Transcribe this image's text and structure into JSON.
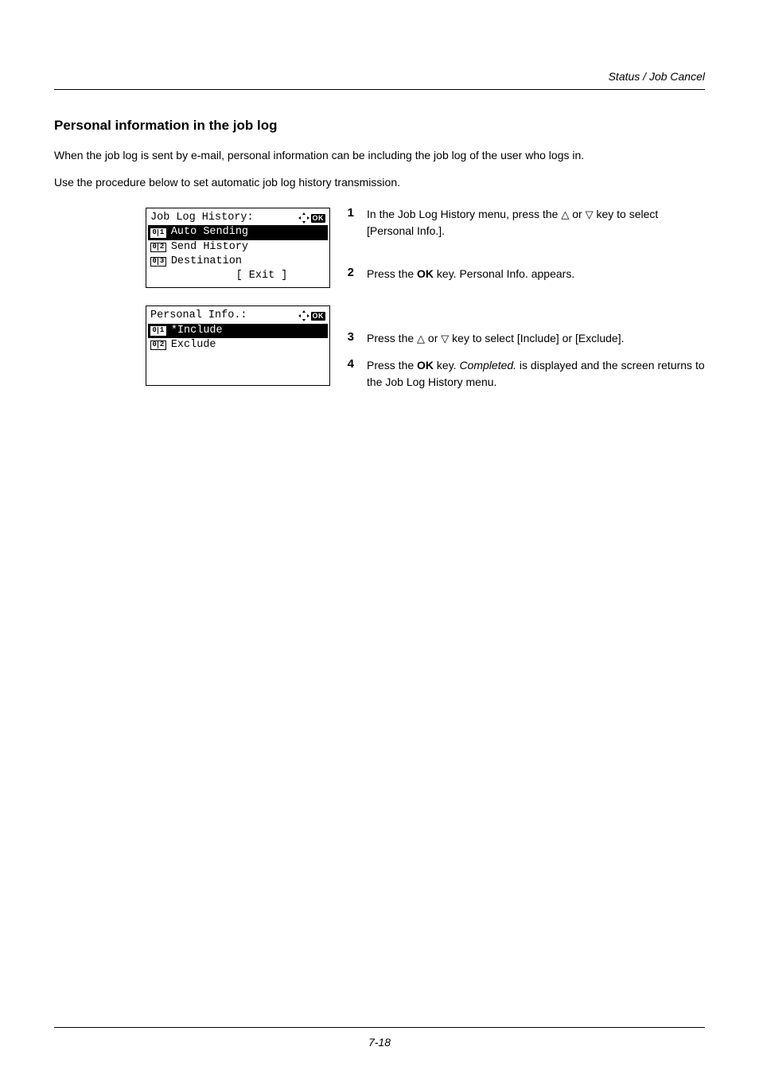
{
  "header": {
    "section": "Status / Job Cancel"
  },
  "title": "Personal information in the job log",
  "intro1": "When the job log is sent by e-mail, personal information can be including the job log of the user who logs in.",
  "intro2": "Use the procedure below to set automatic job log history transmission.",
  "lcd1": {
    "title": "Job Log History:",
    "row1": "Auto Sending",
    "row2": "Send History",
    "row3": "Destination",
    "exit": "[  Exit   ]"
  },
  "lcd2": {
    "title": "Personal Info.:",
    "row1": "*Include",
    "row2": "Exclude"
  },
  "steps": {
    "s1_pre": "In the Job Log History menu, press the ",
    "s1_mid": " or ",
    "s1_post": " key to select [Personal Info.].",
    "s2_pre": "Press the ",
    "s2_ok": "OK",
    "s2_post": " key. Personal Info. appears.",
    "s3_pre": "Press the ",
    "s3_mid": " or ",
    "s3_post": " key to select [Include] or [Exclude].",
    "s4_pre": "Press the ",
    "s4_ok": "OK",
    "s4_mid": " key. ",
    "s4_it": "Completed.",
    "s4_post": " is displayed and the screen returns to the Job Log History menu."
  },
  "footer": {
    "page": "7-18"
  },
  "nums": {
    "n1": "1",
    "n2": "2",
    "n3": "3",
    "n4": "4"
  },
  "badges": {
    "b01_1": "0",
    "b01_2": "1",
    "b02_1": "0",
    "b02_2": "2",
    "b03_1": "0",
    "b03_2": "3",
    "ok": "OK"
  }
}
